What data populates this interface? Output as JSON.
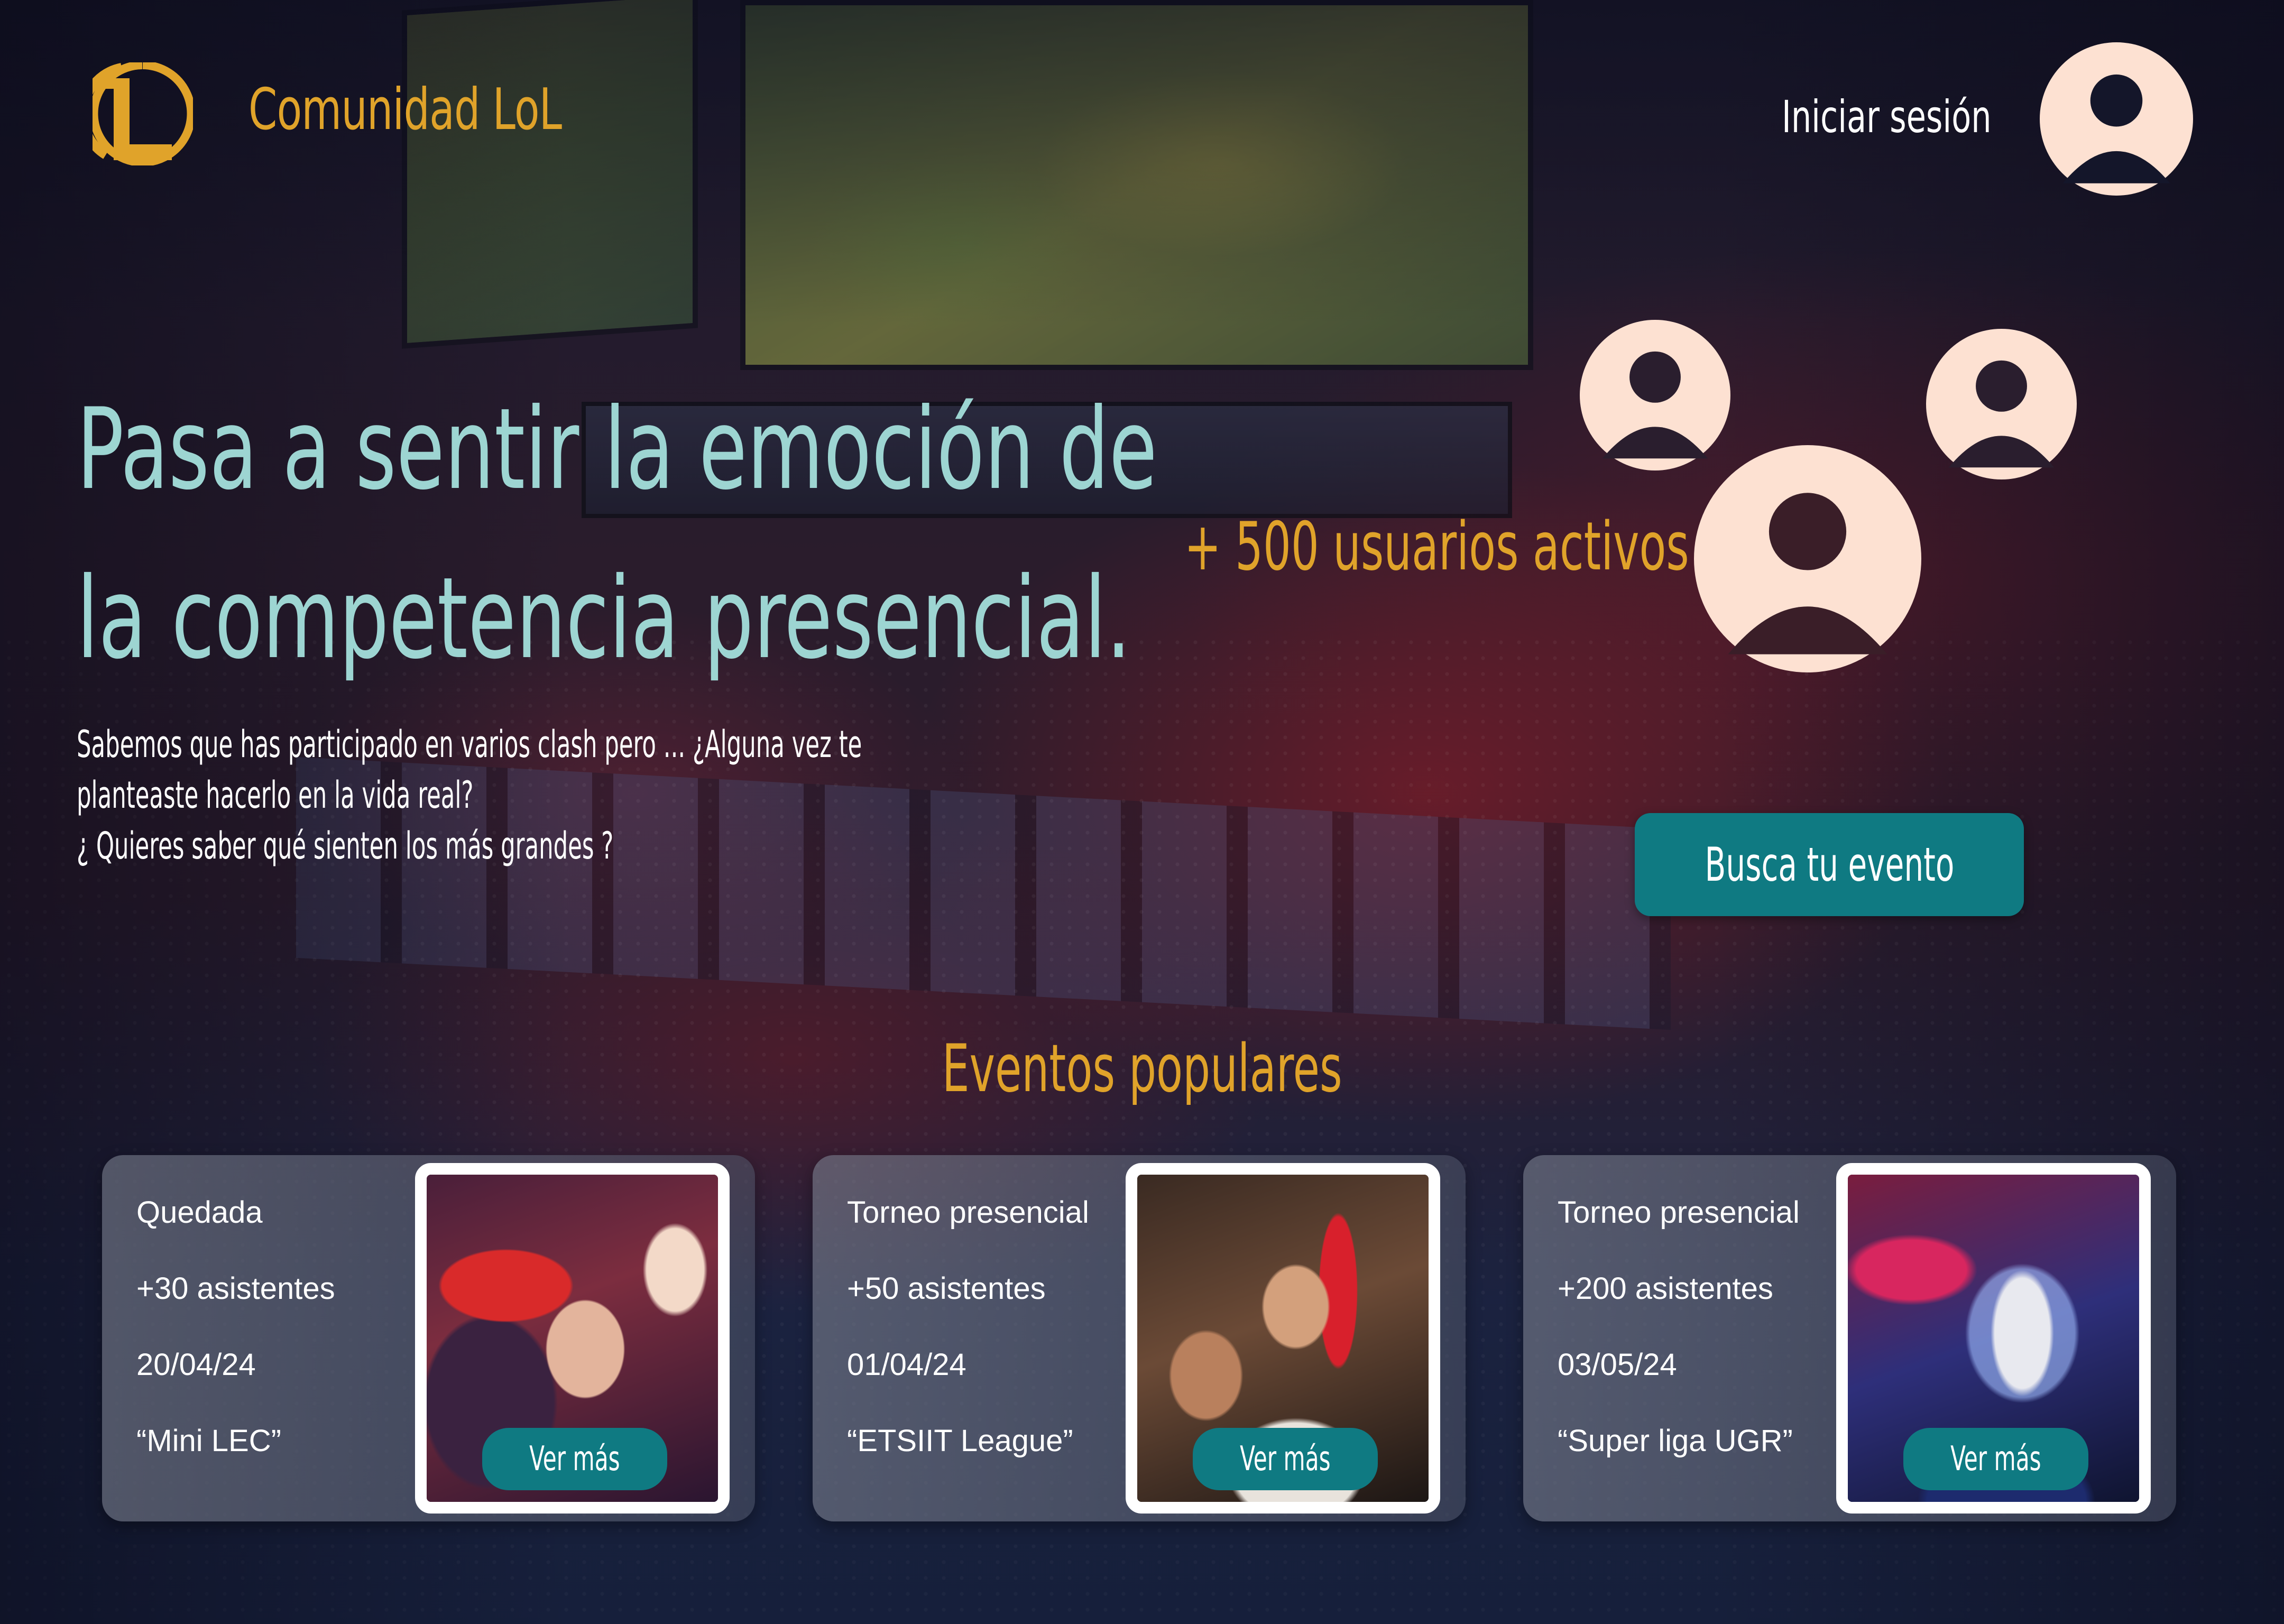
{
  "header": {
    "brand": "Comunidad LoL",
    "login_label": "Iniciar sesión",
    "logo_icon": "league-of-legends-logo",
    "account_icon": "user-avatar-icon"
  },
  "hero": {
    "title_lines": [
      "Pasa a sentir la emoción de",
      "la competencia presencial."
    ],
    "text_lines": [
      "Sabemos que has participado en varios clash pero ... ¿Alguna vez te",
      "planteaste hacerlo en la vida real?",
      "¿ Quieres saber qué sienten los más grandes ?"
    ],
    "active_users": "+ 500 usuarios activos",
    "cta_label": "Busca tu evento"
  },
  "events": {
    "title": "Eventos populares",
    "cards": [
      {
        "type": "Quedada",
        "attendees": "+30 asistentes",
        "date": "20/04/24",
        "name": "“Mini LEC”",
        "button": "Ver más"
      },
      {
        "type": "Torneo presencial",
        "attendees": "+50 asistentes",
        "date": "01/04/24",
        "name": "“ETSIIT League”",
        "button": "Ver más"
      },
      {
        "type": "Torneo presencial",
        "attendees": "+200 asistentes",
        "date": "03/05/24",
        "name": "“Super liga UGR”",
        "button": "Ver más"
      }
    ]
  },
  "colors": {
    "accent_gold": "#e0a32a",
    "title_teal": "#9dd5d2",
    "button_teal": "#0f7a82",
    "avatar_peach": "#fde1d2"
  }
}
